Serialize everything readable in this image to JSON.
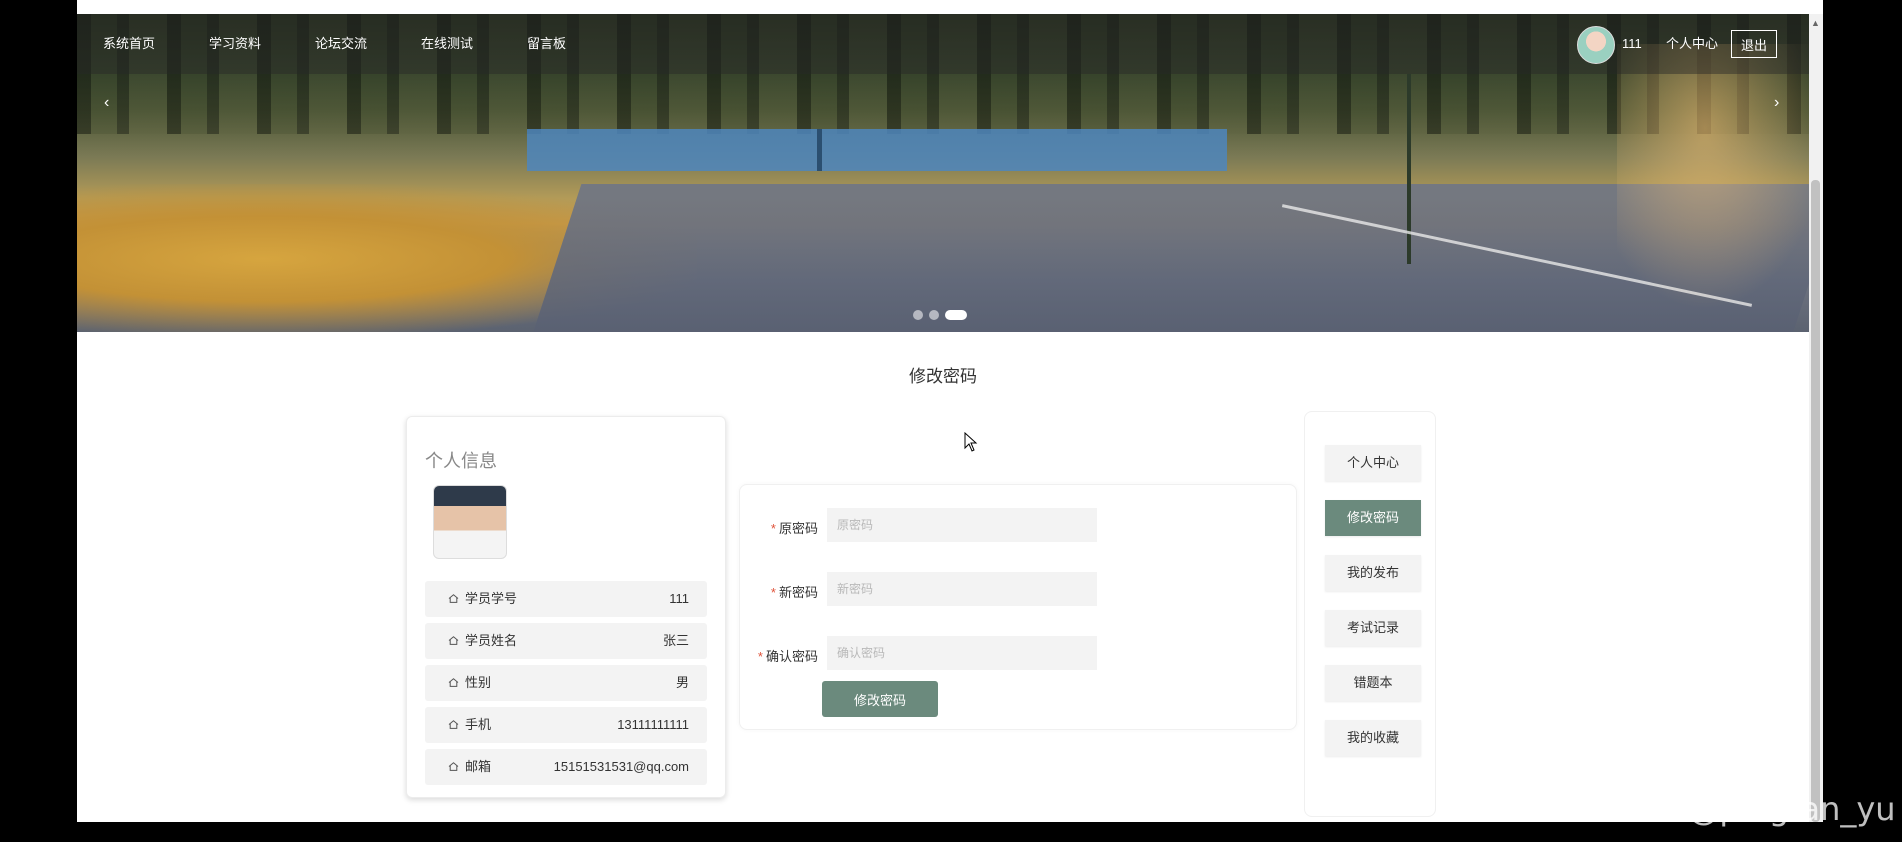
{
  "nav": {
    "items": [
      "系统首页",
      "学习资料",
      "论坛交流",
      "在线测试",
      "留言板"
    ],
    "username": "111",
    "user_center": "个人中心",
    "logout": "退出"
  },
  "carousel": {
    "prev": "‹",
    "next": "›",
    "slide_count": 3,
    "active_index": 2
  },
  "page_title": "修改密码",
  "profile": {
    "title": "个人信息",
    "rows": [
      {
        "label": "学员学号",
        "value": "111"
      },
      {
        "label": "学员姓名",
        "value": "张三"
      },
      {
        "label": "性别",
        "value": "男"
      },
      {
        "label": "手机",
        "value": "13111111111"
      },
      {
        "label": "邮箱",
        "value": "15151531531@qq.com"
      }
    ]
  },
  "form": {
    "fields": [
      {
        "label": "原密码",
        "placeholder": "原密码",
        "required": true
      },
      {
        "label": "新密码",
        "placeholder": "新密码",
        "required": true
      },
      {
        "label": "确认密码",
        "placeholder": "确认密码",
        "required": true
      }
    ],
    "submit": "修改密码"
  },
  "side_menu": {
    "items": [
      "个人中心",
      "修改密码",
      "我的发布",
      "考试记录",
      "错题本",
      "我的收藏"
    ],
    "active_index": 1
  },
  "watermark": "CSDN @pingfan_yu",
  "colors": {
    "accent": "#6b8a7d",
    "required": "#e0533a"
  }
}
